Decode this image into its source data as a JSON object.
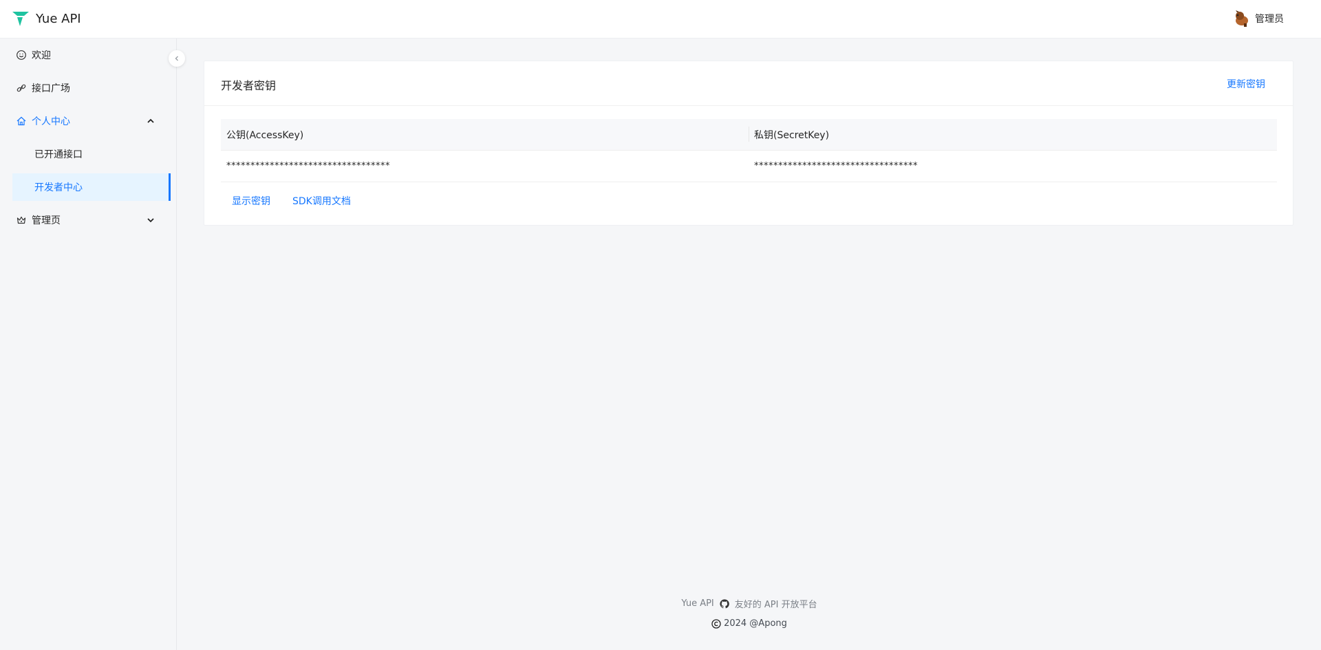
{
  "header": {
    "brand": "Yue API",
    "user_name": "管理员"
  },
  "sidebar": {
    "items": [
      {
        "label": "欢迎",
        "icon": "smile-icon"
      },
      {
        "label": "接口广场",
        "icon": "link-icon"
      },
      {
        "label": "个人中心",
        "icon": "home-icon",
        "expanded": true,
        "children": [
          {
            "label": "已开通接口"
          },
          {
            "label": "开发者中心",
            "active": true
          }
        ]
      },
      {
        "label": "管理页",
        "icon": "crown-icon",
        "expanded": false
      }
    ]
  },
  "card": {
    "title": "开发者密钥",
    "renew_label": "更新密钥",
    "columns": [
      "公钥(AccessKey)",
      "私钥(SecretKey)"
    ],
    "row": [
      "**********************************",
      "**********************************"
    ],
    "actions": {
      "show_key": "显示密钥",
      "sdk_docs": "SDK调用文档"
    }
  },
  "footer": {
    "brand": "Yue API",
    "slogan": "友好的 API 开放平台",
    "copyright": "2024 @Apong"
  },
  "colors": {
    "accent": "#1677ff",
    "logo": "#1fc3a0",
    "active_bg": "#e6f4ff"
  }
}
